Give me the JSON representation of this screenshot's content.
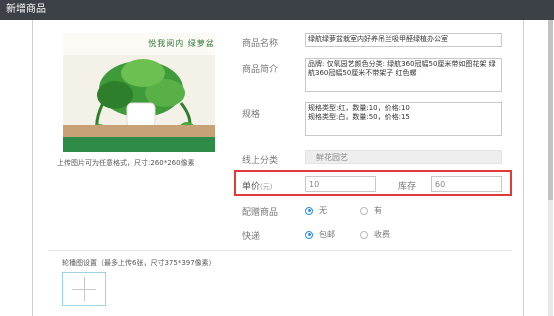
{
  "window": {
    "title": "新增商品"
  },
  "image": {
    "caption": "悦我阅内 绿萝盆栽",
    "upload_hint": "上传图片可为任意格式，尺寸:260*260像素"
  },
  "form": {
    "name": {
      "label": "商品名称",
      "value": "绿航绿萝盆栽室内好养吊兰吸甲醛绿植办公室"
    },
    "intro": {
      "label": "商品简介",
      "value": "品牌: 仅氧园艺颜色分类: 绿航360冠幅50厘米带如图花架 绿航360冠幅50厘米不带架子 红色螺"
    },
    "spec": {
      "label": "规格",
      "value": "规格类型:红，数量:10，价格:10\n规格类型:白，数量:50，价格:15"
    },
    "category": {
      "label": "线上分类",
      "value": "鲜花园艺"
    },
    "price": {
      "label": "单价",
      "unit": "(元)",
      "value": "10"
    },
    "stock": {
      "label": "库存",
      "value": "60"
    },
    "gift": {
      "label": "配赠商品",
      "options": [
        "无",
        "有"
      ],
      "selected": "无"
    },
    "delivery": {
      "label": "快递",
      "options": [
        "包邮",
        "收费"
      ],
      "selected": "包邮"
    }
  },
  "carousel": {
    "label": "轮播图设置（最多上传6张，尺寸375*397像素）"
  },
  "colors": {
    "titlebar": "#3c4148",
    "highlight": "#e03a3a",
    "radio_checked": "#2d8cf0"
  }
}
